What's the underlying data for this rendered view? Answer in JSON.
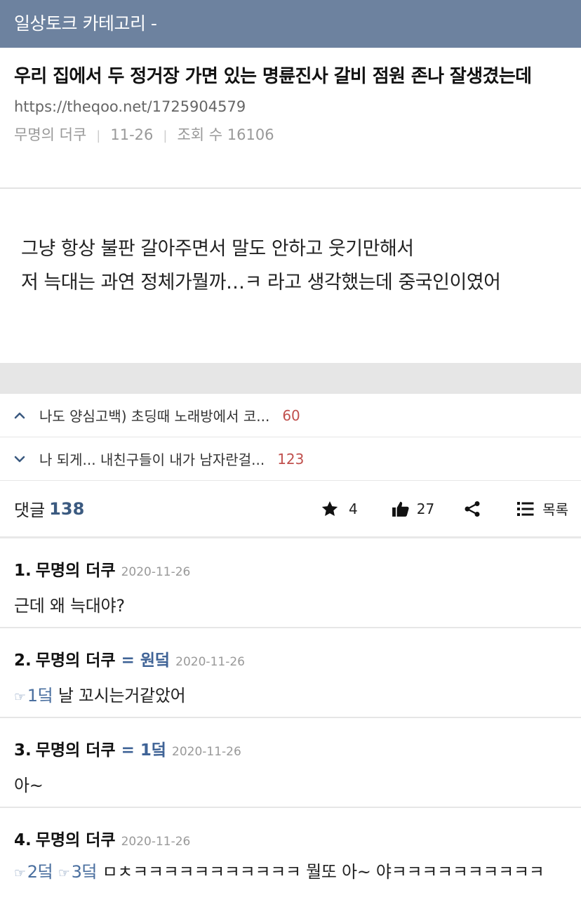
{
  "header": {
    "title": "일상토크 카테고리 -"
  },
  "post": {
    "title": "우리 집에서 두 정거장 가면 있는 명륜진사 갈비 점원 존나 잘생겼는데",
    "url": "https://theqoo.net/1725904579",
    "author": "무명의 더쿠",
    "date": "11-26",
    "views": "조회 수 16106",
    "body_lines": [
      "그냥 항상 불판 갈아주면서 말도 안하고 웃기만해서",
      "저 늑대는 과연 정체가뭘까…ㅋ 라고 생각했는데 중국인이였어"
    ]
  },
  "nav": {
    "prev": {
      "title": "나도 양심고백) 초딩때 노래방에서 코...",
      "count": "60",
      "icon": "chevron-up-icon"
    },
    "next": {
      "title": "나 되게... 내친구들이 내가 남자란걸...",
      "count": "123",
      "icon": "chevron-down-icon"
    }
  },
  "actions": {
    "comment_label": "댓글",
    "comment_count": "138",
    "star_count": "4",
    "like_count": "27",
    "list_label": "목록",
    "icons": [
      "star-icon",
      "thumbs-up-icon",
      "share-icon",
      "list-icon"
    ]
  },
  "comments": [
    {
      "num": "1.",
      "author": "무명의 더쿠",
      "reply_to": "",
      "date": "2020-11-26",
      "text": "근데 왜 늑대야?",
      "refs": []
    },
    {
      "num": "2.",
      "author": "무명의 더쿠",
      "reply_to": "= 원덬",
      "date": "2020-11-26",
      "refs": [
        "1덬"
      ],
      "text": "날 꼬시는거같았어"
    },
    {
      "num": "3.",
      "author": "무명의 더쿠",
      "reply_to": "= 1덬",
      "date": "2020-11-26",
      "text": "아~",
      "refs": []
    },
    {
      "num": "4.",
      "author": "무명의 더쿠",
      "reply_to": "",
      "date": "2020-11-26",
      "refs": [
        "2덬",
        "3덬"
      ],
      "text": "ㅁㅊㅋㅋㅋㅋㅋㅋㅋㅋㅋㅋㅋ 뭘또 아~ 야ㅋㅋㅋㅋㅋㅋㅋㅋㅋㅋ"
    }
  ],
  "colors": {
    "header_bg": "#6d829f",
    "accent": "#3f6396",
    "count_red": "#c0504d"
  }
}
